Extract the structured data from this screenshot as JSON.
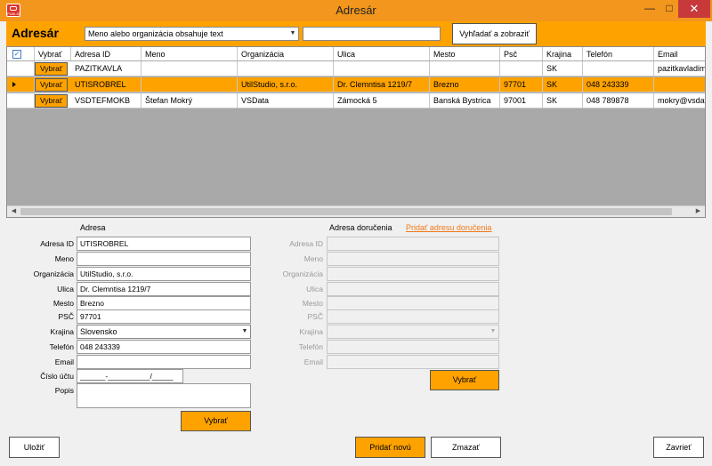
{
  "window": {
    "title": "Adresár",
    "icon_label": "PUBLIS",
    "minimize_icon": "minimize-icon",
    "maximize_icon": "maximize-icon",
    "close_icon": "close-icon"
  },
  "toolbar": {
    "title": "Adresár",
    "filter_select_value": "Meno alebo organizácia obsahuje text",
    "search_value": "",
    "search_button_label": "Vyhľadať a zobraziť"
  },
  "grid": {
    "columns": [
      "Vybrať",
      "Adresa ID",
      "Meno",
      "Organizácia",
      "Ulica",
      "Mesto",
      "Psč",
      "Krajina",
      "Telefón",
      "Email"
    ],
    "row_button_label": "Vybrať",
    "rows": [
      [
        "PAZITKAVLA",
        "",
        "",
        "",
        "",
        "",
        "SK",
        "",
        "pazitkavladimir@"
      ],
      [
        "UTISROBREL",
        "",
        "UtilStudio, s.r.o.",
        "Dr. Clemntisa 1219/7",
        "Brezno",
        "97701",
        "SK",
        "048 243339",
        ""
      ],
      [
        "VSDTEFMOKB",
        "Štefan Mokrý",
        "VSData",
        "Zámocká 5",
        "Banská Bystrica",
        "97001",
        "SK",
        "048 789878",
        "mokry@vsdata.s"
      ]
    ],
    "selected_row": 1
  },
  "address": {
    "section_title": "Adresa",
    "labels": {
      "id": "Adresa ID",
      "name": "Meno",
      "org": "Organizácia",
      "street": "Ulica",
      "city": "Mesto",
      "zip": "PSČ",
      "country": "Krajina",
      "phone": "Telefón",
      "email": "Email",
      "account": "Číslo účtu",
      "note": "Popis"
    },
    "values": {
      "id": "UTISROBREL",
      "name": "",
      "org": "UtilStudio, s.r.o.",
      "street": "Dr. Clemntisa 1219/7",
      "city": "Brezno",
      "zip": "97701",
      "country": "Slovensko",
      "phone": "048 243339",
      "email": "",
      "account": "______-__________/_____",
      "note": ""
    },
    "select_button_label": "Vybrať"
  },
  "delivery": {
    "section_title": "Adresa doručenia",
    "add_link_label": "Pridať adresu doručenia",
    "labels": {
      "id": "Adresa ID",
      "name": "Meno",
      "org": "Organizácia",
      "street": "Ulica",
      "city": "Mesto",
      "zip": "PSČ",
      "country": "Krajina",
      "phone": "Telefón",
      "email": "Email"
    },
    "select_button_label": "Vybrať"
  },
  "footer": {
    "save_label": "Uložiť",
    "add_new_label": "Pridať novú",
    "delete_label": "Zmazať",
    "close_label": "Zavrieť"
  },
  "colors": {
    "accent": "#fea200",
    "titlebar": "#f3961d",
    "close_button": "#c7393b",
    "link": "#f07a1a"
  }
}
